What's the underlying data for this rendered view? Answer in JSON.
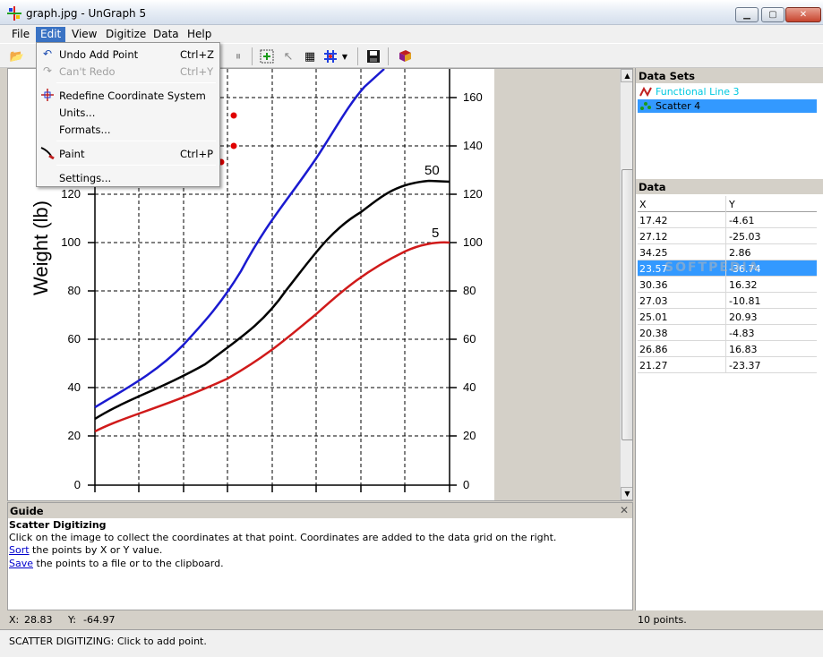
{
  "window": {
    "title": "graph.jpg - UnGraph 5"
  },
  "menubar": [
    "File",
    "Edit",
    "View",
    "Digitize",
    "Data",
    "Help"
  ],
  "edit_menu": {
    "items": [
      {
        "label": "Undo Add Point",
        "shortcut": "Ctrl+Z",
        "icon": "undo-icon",
        "enabled": true
      },
      {
        "label": "Can't Redo",
        "shortcut": "Ctrl+Y",
        "icon": "redo-icon",
        "enabled": false
      },
      {
        "label": "Redefine Coordinate System",
        "shortcut": "",
        "icon": "crosshair-icon",
        "enabled": true
      },
      {
        "label": "Units...",
        "shortcut": "",
        "icon": "",
        "enabled": true
      },
      {
        "label": "Formats...",
        "shortcut": "",
        "icon": "",
        "enabled": true
      },
      {
        "label": "Paint",
        "shortcut": "Ctrl+P",
        "icon": "paint-icon",
        "enabled": true
      },
      {
        "label": "Settings...",
        "shortcut": "",
        "icon": "",
        "enabled": true
      }
    ]
  },
  "graph": {
    "y_axis_label": "Weight (lb)",
    "left_ticks": [
      "0",
      "20",
      "40",
      "60",
      "80",
      "100",
      "120"
    ],
    "right_ticks": [
      "0",
      "20",
      "40",
      "60",
      "80",
      "100",
      "120",
      "140",
      "160"
    ],
    "curve_labels": [
      "50",
      "5"
    ],
    "colors": {
      "blue": "#1a1ad0",
      "black": "#000000",
      "red": "#d01a1a",
      "points": "#e00000"
    }
  },
  "datasets": {
    "title": "Data Sets",
    "items": [
      {
        "name": "Functional Line 3",
        "color": "#00c8e0",
        "selected": false
      },
      {
        "name": "Scatter 4",
        "color": "#000000",
        "selected": true
      }
    ]
  },
  "data": {
    "title": "Data",
    "columns": [
      "X",
      "Y"
    ],
    "rows": [
      [
        "17.42",
        "-4.61"
      ],
      [
        "27.12",
        "-25.03"
      ],
      [
        "34.25",
        "2.86"
      ],
      [
        "23.57",
        "-36.74"
      ],
      [
        "30.36",
        "16.32"
      ],
      [
        "27.03",
        "-10.81"
      ],
      [
        "25.01",
        "20.93"
      ],
      [
        "20.38",
        "-4.83"
      ],
      [
        "26.86",
        "16.83"
      ],
      [
        "21.27",
        "-23.37"
      ]
    ],
    "selected_row": 3,
    "watermark": "SOFTPEDIA"
  },
  "guide": {
    "title": "Guide",
    "heading": "Scatter Digitizing",
    "line1": "Click on the image to collect the coordinates at that point. Coordinates are added to the data grid on the right.",
    "sort_link": "Sort",
    "sort_text": " the points by X or Y value.",
    "save_link": "Save",
    "save_text": " the points to a file or to the clipboard."
  },
  "coords": {
    "x_label": "X:",
    "x_value": "28.83",
    "y_label": "Y:",
    "y_value": "-64.97",
    "count": "10 points."
  },
  "status": "SCATTER DIGITIZING: Click to add point."
}
